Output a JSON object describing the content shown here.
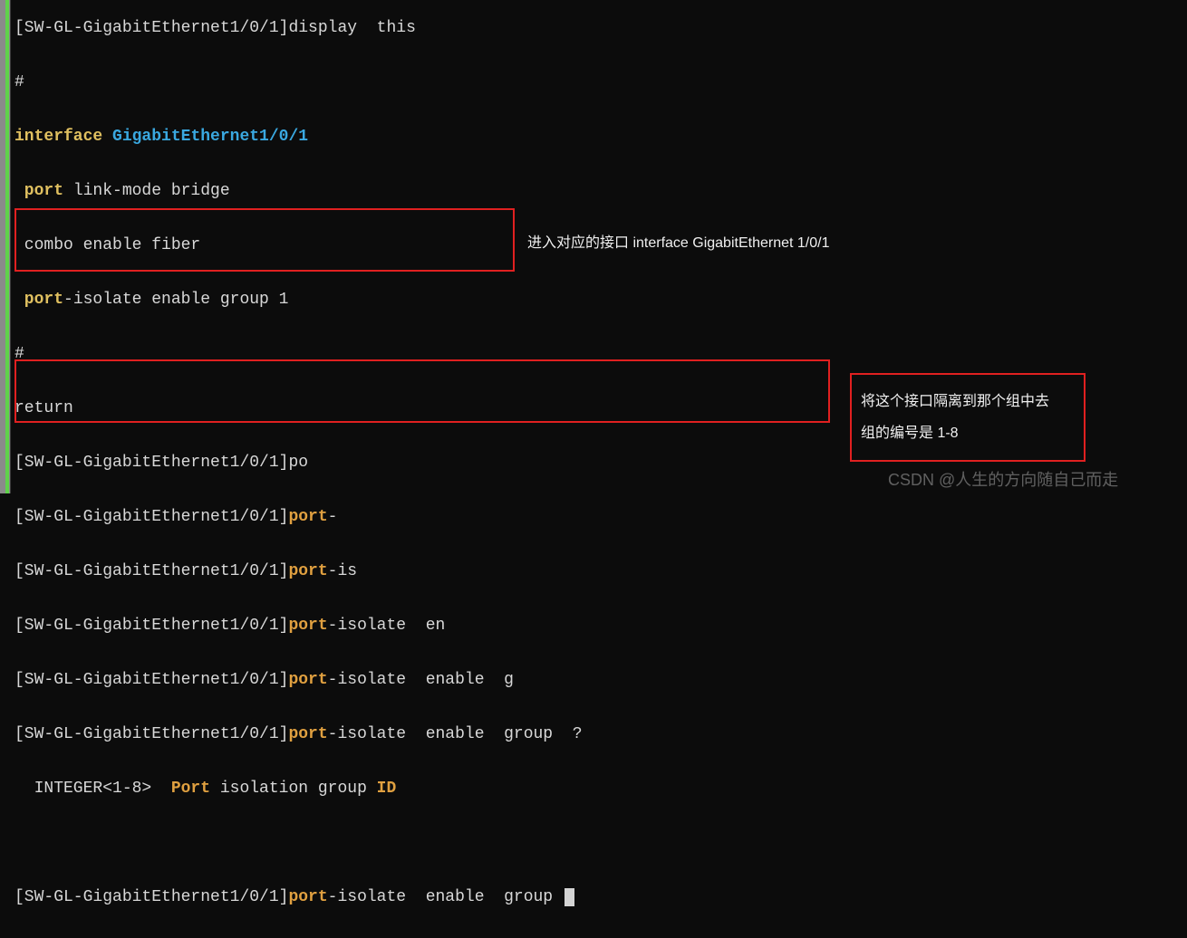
{
  "lines": {
    "l0_prefix": "[SW-GL-GigabitEthernet1/0/1]",
    "l0_cmd": "display  this",
    "hash": "#",
    "kw_interface": "interface ",
    "kw_ifname": "GigabitEthernet1/0/1",
    "kw_port1": " port ",
    "kw_port1_txt": "link-mode bridge",
    "combo": " combo enable fiber",
    "kw_port2": " port",
    "kw_port2_txt": "-isolate enable group 1",
    "return": "return",
    "p_prefix": "[SW-GL-GigabitEthernet1/0/1]",
    "p1": "po",
    "p2_a": "port",
    "p2_b": "-",
    "p3_a": "port",
    "p3_b": "-is",
    "p4_a": "port",
    "p4_b": "-isolate  en",
    "p5_a": "port",
    "p5_b": "-isolate  enable  g",
    "p6_a": "port",
    "p6_b": "-isolate  enable  group  ?",
    "help_pre": "  INTEGER<1-8>  ",
    "help_port": "Port ",
    "help_mid": "isolation group ",
    "help_id": "ID",
    "p7_a": "port",
    "p7_b": "-isolate  enable  group "
  },
  "annotation1": "进入对应的接口  interface GigabitEthernet 1/0/1",
  "annotation2_line1": "将这个接口隔离到那个组中去",
  "annotation2_line2": "组的编号是 1-8",
  "watermark": "CSDN @人生的方向随自己而走"
}
